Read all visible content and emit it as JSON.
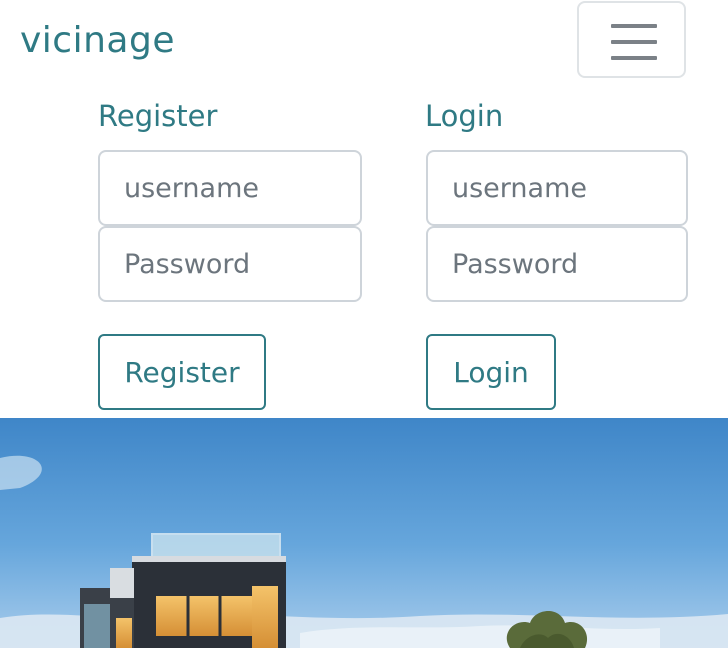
{
  "brand": {
    "name": "vicinage"
  },
  "navbar": {
    "toggle_icon": "hamburger-menu-icon"
  },
  "register": {
    "title": "Register",
    "username_placeholder": "username",
    "password_placeholder": "Password",
    "submit_label": "Register"
  },
  "login": {
    "title": "Login",
    "username_placeholder": "username",
    "password_placeholder": "Password",
    "submit_label": "Login"
  },
  "hero": {
    "icon": "house-photo"
  },
  "colors": {
    "accent": "#2f7a84",
    "input_border": "#ced4da",
    "placeholder": "#6c757d",
    "toggler_bar": "#7b8187"
  }
}
